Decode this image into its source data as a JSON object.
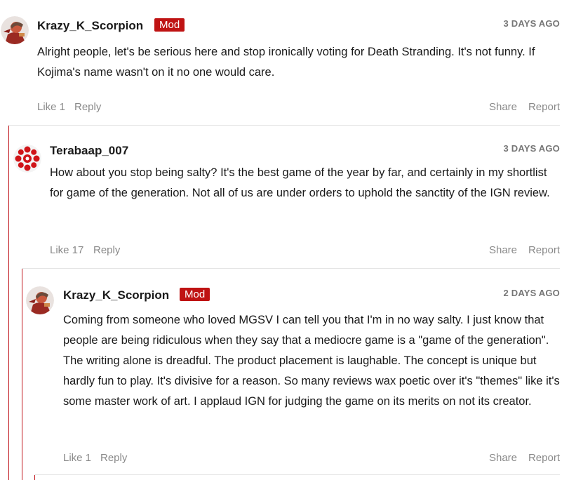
{
  "comments": [
    {
      "username": "Krazy_K_Scorpion",
      "badge": "Mod",
      "time": "3 DAYS AGO",
      "text": "Alright people, let's be serious here and stop ironically voting for Death Stranding. It's not funny. If Kojima's name wasn't on it no one would care.",
      "like": "Like 1",
      "reply": "Reply",
      "share": "Share",
      "report": "Report",
      "avatar_icon": "scorpion-avatar-icon"
    },
    {
      "username": "Terabaap_007",
      "badge": "",
      "time": "3 DAYS AGO",
      "text": "How about you stop being salty? It's the best game of the year by far, and certainly in my shortlist for game of the generation. Not all of us are under orders to uphold the sanctity of the IGN review.",
      "like": "Like 17",
      "reply": "Reply",
      "share": "Share",
      "report": "Report",
      "avatar_icon": "ign-logo-icon"
    },
    {
      "username": "Krazy_K_Scorpion",
      "badge": "Mod",
      "time": "2 DAYS AGO",
      "text": "Coming from someone who loved MGSV I can tell you that I'm in no way salty. I just know that people are being ridiculous when they say that a mediocre game is a \"game of the generation\". The writing alone is dreadful. The product placement is laughable. The concept is unique but hardly fun to play. It's divisive for a reason. So many reviews wax poetic over it's \"themes\" like it's some master work of art. I applaud IGN for judging the game on its merits on not its creator.",
      "like": "Like 1",
      "reply": "Reply",
      "share": "Share",
      "report": "Report",
      "avatar_icon": "scorpion-avatar-icon"
    }
  ],
  "colors": {
    "accent": "#bf1313",
    "thread_line": "#c0161c",
    "meta_text": "#8a8a8a",
    "time_text": "#767676"
  }
}
